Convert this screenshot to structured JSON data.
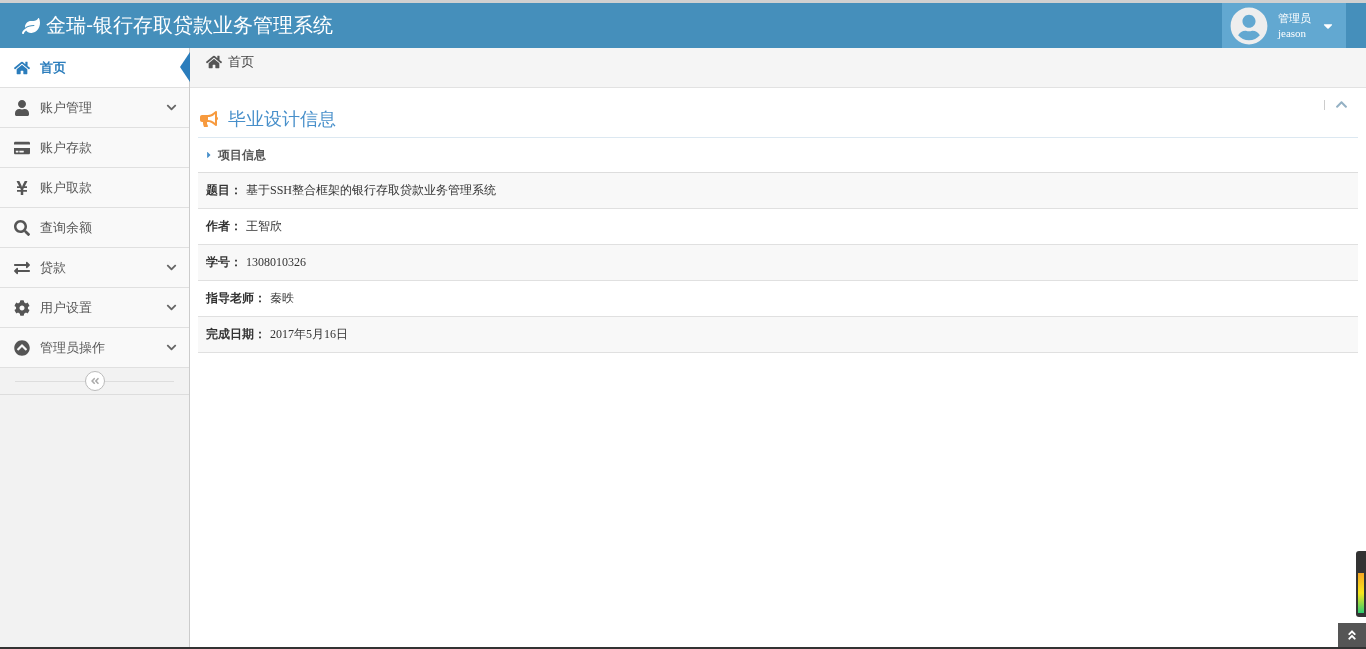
{
  "header": {
    "title": "金瑞-银行存取贷款业务管理系统",
    "user": {
      "role": "管理员",
      "name": "jeason"
    }
  },
  "sidebar": {
    "items": [
      {
        "label": "首页",
        "selected": true,
        "expandable": false
      },
      {
        "label": "账户管理",
        "selected": false,
        "expandable": true
      },
      {
        "label": "账户存款",
        "selected": false,
        "expandable": false
      },
      {
        "label": "账户取款",
        "selected": false,
        "expandable": false
      },
      {
        "label": "查询余额",
        "selected": false,
        "expandable": false
      },
      {
        "label": "贷款",
        "selected": false,
        "expandable": true
      },
      {
        "label": "用户设置",
        "selected": false,
        "expandable": true
      },
      {
        "label": "管理员操作",
        "selected": false,
        "expandable": true
      }
    ]
  },
  "breadcrumb": [
    "首页"
  ],
  "panel": {
    "title": "毕业设计信息",
    "section": "项目信息",
    "rows": [
      {
        "label": "题目：",
        "value": "基于SSH整合框架的银行存取贷款业务管理系统"
      },
      {
        "label": "作者：",
        "value": "王智欣"
      },
      {
        "label": "学号：",
        "value": "1308010326"
      },
      {
        "label": "指导老师：",
        "value": "秦昳"
      },
      {
        "label": "完成日期：",
        "value": "2017年5月16日"
      }
    ]
  }
}
